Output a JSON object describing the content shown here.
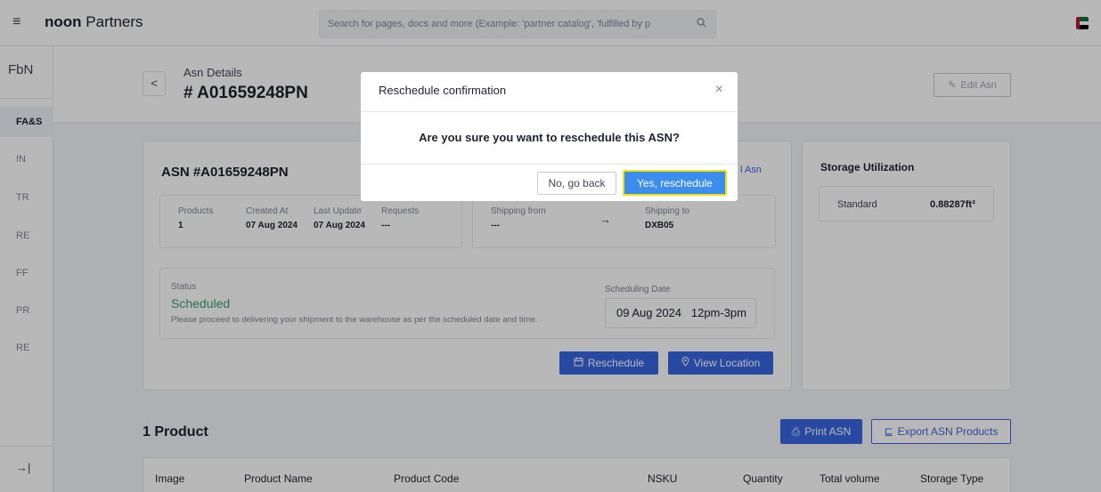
{
  "header": {
    "menu_icon": "hamburger-icon",
    "brand_bold": "noon",
    "brand_rest": " Partners",
    "search_placeholder": "Search for pages, docs and more (Example: 'partner catalog', 'fulfilled by p",
    "search_icon": "search-icon",
    "flag_icon": "uae-flag-icon"
  },
  "sidebar": {
    "title": "FbN",
    "items": [
      {
        "label": "FA&S",
        "active": true
      },
      {
        "label": "IN"
      },
      {
        "label": "TR"
      },
      {
        "label": "RE"
      },
      {
        "label": "FF"
      },
      {
        "label": "PR"
      },
      {
        "label": "RE"
      }
    ],
    "collapse_icon": "collapse-arrow-icon"
  },
  "page": {
    "back_label": "<",
    "asn_label": "Asn Details",
    "asn_number": "# A01659248PN",
    "edit_label": "Edit Asn",
    "edit_icon": "pencil-icon"
  },
  "asn_card": {
    "title": "ASN #A01659248PN",
    "link_partial": "l Asn",
    "fields": [
      {
        "label": "Products",
        "value": "1"
      },
      {
        "label": "Created At",
        "value": "07 Aug 2024"
      },
      {
        "label": "Last Update",
        "value": "07 Aug 2024"
      },
      {
        "label": "Requests",
        "value": "---"
      }
    ],
    "shipping_from_label": "Shipping from",
    "shipping_from_value": "---",
    "shipping_to_label": "Shipping to",
    "shipping_to_value": "DXB05",
    "arrow": "→",
    "status_label": "Status",
    "status_value": "Scheduled",
    "status_desc": "Please proceed to delivering your shipment to the warehouse as per the scheduled date and time.",
    "scheduling_label": "Scheduling Date",
    "scheduling_value": "09 Aug 2024   12pm-3pm",
    "reschedule_label": "Reschedule",
    "reschedule_icon": "calendar-icon",
    "view_location_label": "View Location",
    "location_icon": "location-pin-icon"
  },
  "storage": {
    "title": "Storage Utilization",
    "row_label": "Standard",
    "row_value": "0.88287ft³"
  },
  "products": {
    "title": "1 Product",
    "print_label": "Print ASN",
    "print_icon": "printer-icon",
    "export_label": "Export ASN Products",
    "export_icon": "export-icon",
    "columns": [
      "Image",
      "Product Name",
      "Product Code",
      "NSKU",
      "Quantity",
      "Total volume",
      "Storage Type"
    ]
  },
  "modal": {
    "title": "Reschedule confirmation",
    "close": "×",
    "message": "Are you sure you want to reschedule this ASN?",
    "cancel_label": "No, go back",
    "confirm_label": "Yes, reschedule"
  },
  "colors": {
    "accent": "#3866df",
    "confirm": "#3b8ef0",
    "status_green": "#38a36c",
    "highlight": "#f5e000"
  }
}
